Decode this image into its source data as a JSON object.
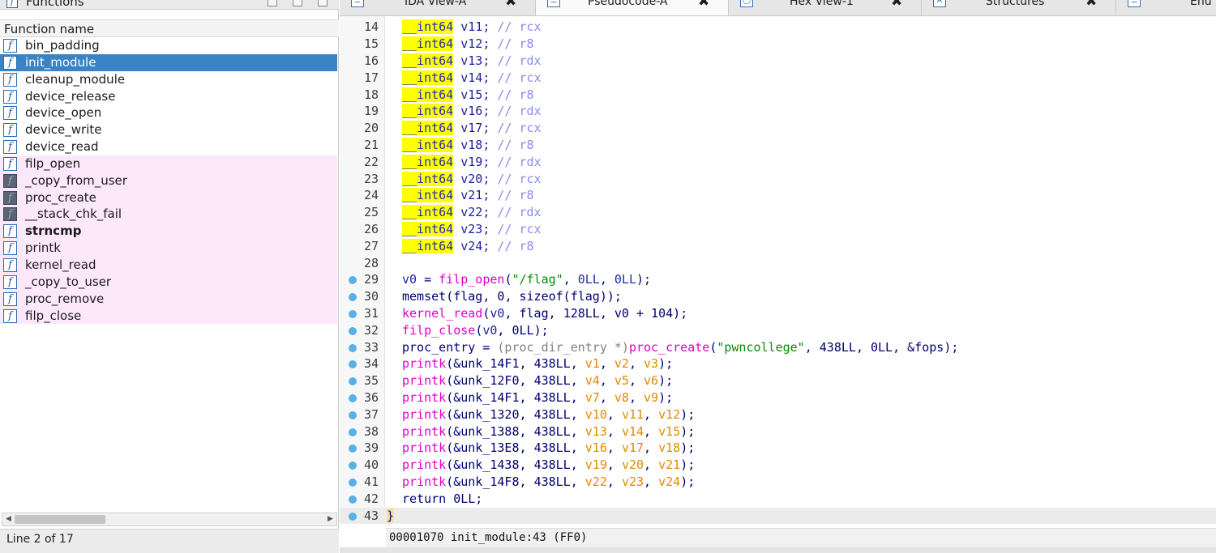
{
  "functions_window": {
    "title": "Functions",
    "column_header": "Function name",
    "status": "Line 2 of 17",
    "items": [
      {
        "name": "bin_padding",
        "kind": "regular"
      },
      {
        "name": "init_module",
        "kind": "selected"
      },
      {
        "name": "cleanup_module",
        "kind": "regular"
      },
      {
        "name": "device_release",
        "kind": "regular"
      },
      {
        "name": "device_open",
        "kind": "regular"
      },
      {
        "name": "device_write",
        "kind": "regular"
      },
      {
        "name": "device_read",
        "kind": "regular"
      },
      {
        "name": "filp_open",
        "kind": "library"
      },
      {
        "name": "_copy_from_user",
        "kind": "import"
      },
      {
        "name": "proc_create",
        "kind": "import"
      },
      {
        "name": "__stack_chk_fail",
        "kind": "import"
      },
      {
        "name": "strncmp",
        "kind": "library-bold"
      },
      {
        "name": "printk",
        "kind": "library"
      },
      {
        "name": "kernel_read",
        "kind": "library"
      },
      {
        "name": "_copy_to_user",
        "kind": "library"
      },
      {
        "name": "proc_remove",
        "kind": "library"
      },
      {
        "name": "filp_close",
        "kind": "library"
      }
    ]
  },
  "tabs": [
    {
      "label": "IDA View-A",
      "active": false,
      "icon": "ida-view-icon"
    },
    {
      "label": "Pseudocode-A",
      "active": true,
      "icon": "pseudocode-icon"
    },
    {
      "label": "Hex View-1",
      "active": false,
      "icon": "hex-view-icon"
    },
    {
      "label": "Structures",
      "active": false,
      "icon": "structures-icon"
    },
    {
      "label": "Enu",
      "active": false,
      "icon": "enums-icon"
    }
  ],
  "code": {
    "decl_type": "__int64",
    "decls": [
      {
        "line": "14",
        "var": "v11",
        "reg": "rcx"
      },
      {
        "line": "15",
        "var": "v12",
        "reg": "r8"
      },
      {
        "line": "16",
        "var": "v13",
        "reg": "rdx"
      },
      {
        "line": "17",
        "var": "v14",
        "reg": "rcx"
      },
      {
        "line": "18",
        "var": "v15",
        "reg": "r8"
      },
      {
        "line": "19",
        "var": "v16",
        "reg": "rdx"
      },
      {
        "line": "20",
        "var": "v17",
        "reg": "rcx"
      },
      {
        "line": "21",
        "var": "v18",
        "reg": "r8"
      },
      {
        "line": "22",
        "var": "v19",
        "reg": "rdx"
      },
      {
        "line": "23",
        "var": "v20",
        "reg": "rcx"
      },
      {
        "line": "24",
        "var": "v21",
        "reg": "r8"
      },
      {
        "line": "25",
        "var": "v22",
        "reg": "rdx"
      },
      {
        "line": "26",
        "var": "v23",
        "reg": "rcx"
      },
      {
        "line": "27",
        "var": "v24",
        "reg": "r8"
      }
    ],
    "blank_line": "28",
    "stmts": {
      "l29": {
        "line": "29",
        "var": "v0",
        "fn": "filp_open",
        "str": "\"/flag\"",
        "a1": "0LL",
        "a2": "0LL"
      },
      "l30": {
        "line": "30",
        "fn": "memset",
        "a0": "flag",
        "a1": "0",
        "a2": "sizeof(flag)"
      },
      "l31": {
        "line": "31",
        "fn": "kernel_read",
        "a0": "v0",
        "a1": "flag",
        "a2": "128LL",
        "a3": "v0 + 104"
      },
      "l32": {
        "line": "32",
        "fn": "filp_close",
        "a0": "v0",
        "a1": "0LL"
      },
      "l33": {
        "line": "33",
        "var": "proc_entry",
        "cast": "(proc_dir_entry *)",
        "fn": "proc_create",
        "str": "\"pwncollege\"",
        "a1": "438LL",
        "a2": "0LL",
        "a3": "&fops"
      },
      "l42": {
        "line": "42",
        "text": "return 0LL;"
      },
      "l43": {
        "line": "43",
        "text": "}"
      }
    },
    "printks": [
      {
        "line": "34",
        "unk": "&unk_14F1",
        "n": "438LL",
        "v": [
          "v1",
          "v2",
          "v3"
        ]
      },
      {
        "line": "35",
        "unk": "&unk_12F0",
        "n": "438LL",
        "v": [
          "v4",
          "v5",
          "v6"
        ]
      },
      {
        "line": "36",
        "unk": "&unk_14F1",
        "n": "438LL",
        "v": [
          "v7",
          "v8",
          "v9"
        ]
      },
      {
        "line": "37",
        "unk": "&unk_1320",
        "n": "438LL",
        "v": [
          "v10",
          "v11",
          "v12"
        ]
      },
      {
        "line": "38",
        "unk": "&unk_1388",
        "n": "438LL",
        "v": [
          "v13",
          "v14",
          "v15"
        ]
      },
      {
        "line": "39",
        "unk": "&unk_13E8",
        "n": "438LL",
        "v": [
          "v16",
          "v17",
          "v18"
        ]
      },
      {
        "line": "40",
        "unk": "&unk_1438",
        "n": "438LL",
        "v": [
          "v19",
          "v20",
          "v21"
        ]
      },
      {
        "line": "41",
        "unk": "&unk_14F8",
        "n": "438LL",
        "v": [
          "v22",
          "v23",
          "v24"
        ]
      }
    ]
  },
  "code_status": "00001070 init_module:43 (FF0)",
  "colors": {
    "selection": "#3a83c4",
    "library_bg": "#fce8fb",
    "keyword_bg": "#ffff00",
    "function_call": "#e000c8",
    "string": "#0a8a0a",
    "global_var": "#e08a00",
    "breakpoint_dot": "#57b1e6"
  }
}
